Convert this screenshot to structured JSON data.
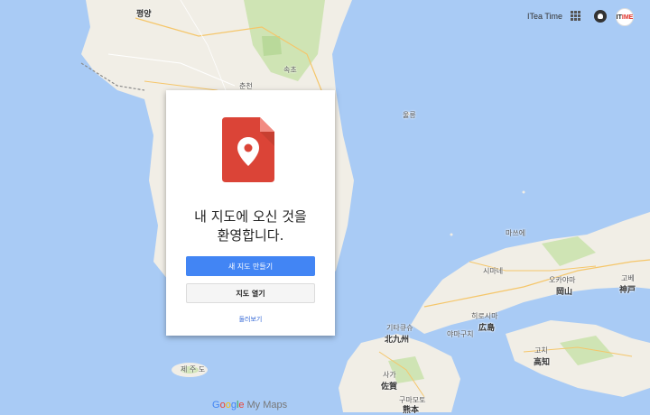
{
  "colors": {
    "sea": "#a9cbf5",
    "land": "#f1eee6",
    "green_area": "#cfe4b4",
    "primary_button": "#4285f4",
    "doc_icon": "#db4437"
  },
  "topbar": {
    "user_name": "ITea Time",
    "apps_icon": "apps-grid-icon",
    "notifications_icon": "notifications-icon",
    "avatar_text_black": "IT",
    "avatar_text_red": "IME"
  },
  "map_labels": {
    "pyongyang": "평양",
    "chuncheon": "춘천",
    "sokcho": "속초",
    "ulleung": "울릉",
    "mysen": "마쓰에",
    "shimane": "시마네",
    "okayama_kana": "오카야마",
    "okayama": "岡山",
    "hiroshima_kana": "히로시마",
    "hiroshima": "広島",
    "kitakyushu_kana": "기타큐슈",
    "kitakyushu": "北九州",
    "kobe_kana": "고베",
    "kobe": "神戸",
    "yamaguchi": "야마구치",
    "kochi_kana": "고치",
    "kochi": "高知",
    "jeju": "제 주 도",
    "saga_kana": "사가",
    "saga": "佐賀",
    "kumamoto_kana": "구마모토",
    "kumamoto": "熊本"
  },
  "dialog": {
    "icon": "my-maps-document-pin-icon",
    "welcome_line1": "내 지도에 오신 것을",
    "welcome_line2": "환영합니다.",
    "create_button": "새 지도 만들기",
    "open_button": "지도 열기",
    "browse_link": "둘러보기"
  },
  "brand": {
    "google": "Google",
    "product": "My Maps"
  }
}
